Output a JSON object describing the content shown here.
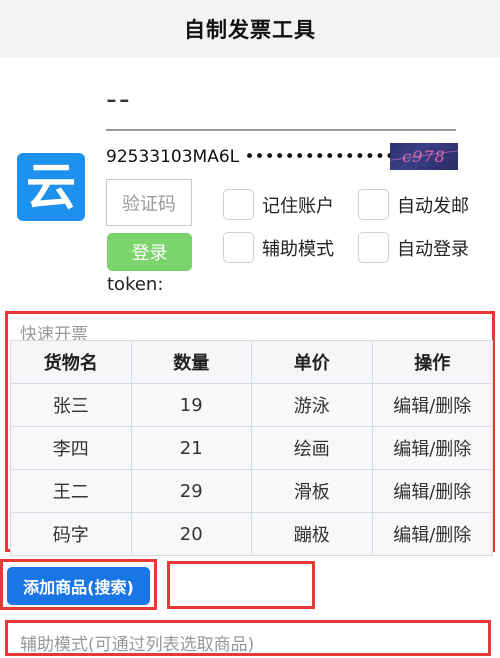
{
  "header": {
    "title": "自制发票工具"
  },
  "logo": {
    "char": "云",
    "icon": "cloud-char-icon",
    "color": "#1e90ee"
  },
  "company": {
    "name": "--"
  },
  "account": {
    "tax_id": "92533103MA6L",
    "password_mask": "•••••••••••••••"
  },
  "captcha": {
    "text": "c978"
  },
  "login": {
    "code_placeholder": "验证码",
    "login_label": "登录",
    "remember_label": "记住账户",
    "auto_send_label": "自动发邮",
    "assist_mode_label": "辅助模式",
    "auto_login_label": "自动登录",
    "token_label": "token:"
  },
  "quick": {
    "title": "快速开票",
    "columns": [
      "货物名",
      "数量",
      "单价",
      "操作"
    ],
    "rows": [
      {
        "name": "张三",
        "qty": "19",
        "price": "游泳",
        "action": "编辑/删除"
      },
      {
        "name": "李四",
        "qty": "21",
        "price": "绘画",
        "action": "编辑/删除"
      },
      {
        "name": "王二",
        "qty": "29",
        "price": "滑板",
        "action": "编辑/删除"
      },
      {
        "name": "码字",
        "qty": "20",
        "price": "蹦极",
        "action": "编辑/删除"
      }
    ]
  },
  "actions": {
    "add_label": "添加商品(搜索)"
  },
  "assist": {
    "label": "辅助模式(可通过列表选取商品)"
  },
  "colors": {
    "highlight": "#e53935",
    "primary": "#1976e6",
    "success": "#7bd46c"
  }
}
